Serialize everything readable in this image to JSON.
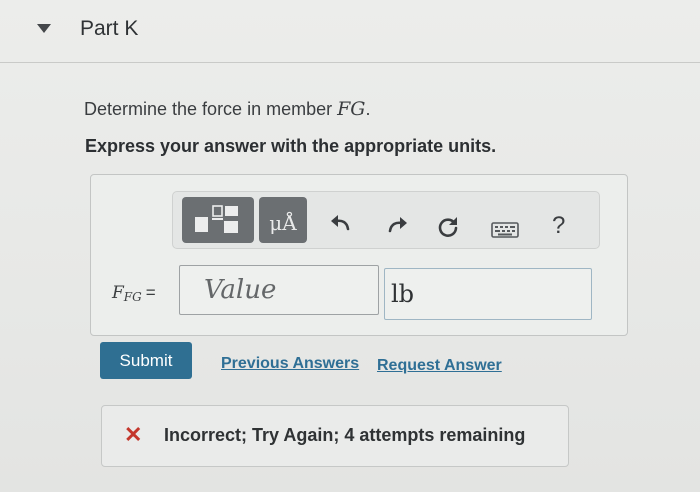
{
  "part": {
    "title": "Part K",
    "collapse_icon": "triangle-down"
  },
  "question": {
    "prefix": "Determine the force in member ",
    "member": "FG",
    "suffix": ".",
    "instruction": "Express your answer with the appropriate units."
  },
  "toolbar": {
    "templates_icon": "templates-icon",
    "units_label": "μÅ",
    "undo_icon": "undo-icon",
    "redo_icon": "redo-icon",
    "reset_icon": "reset-icon",
    "keyboard_icon": "keyboard-icon",
    "help_label": "?"
  },
  "answer": {
    "label_main": "F",
    "label_sub": "FG",
    "equals": "=",
    "value_placeholder": "Value",
    "unit_value": "lb"
  },
  "actions": {
    "submit_label": "Submit",
    "previous_answers_label": "Previous Answers",
    "request_answer_label": "Request Answer"
  },
  "feedback": {
    "icon": "x-icon",
    "message": "Incorrect; Try Again; 4 attempts remaining",
    "color": "#c4372c"
  },
  "colors": {
    "accent": "#2f6f92",
    "toolbar_button": "#6b6f72"
  }
}
